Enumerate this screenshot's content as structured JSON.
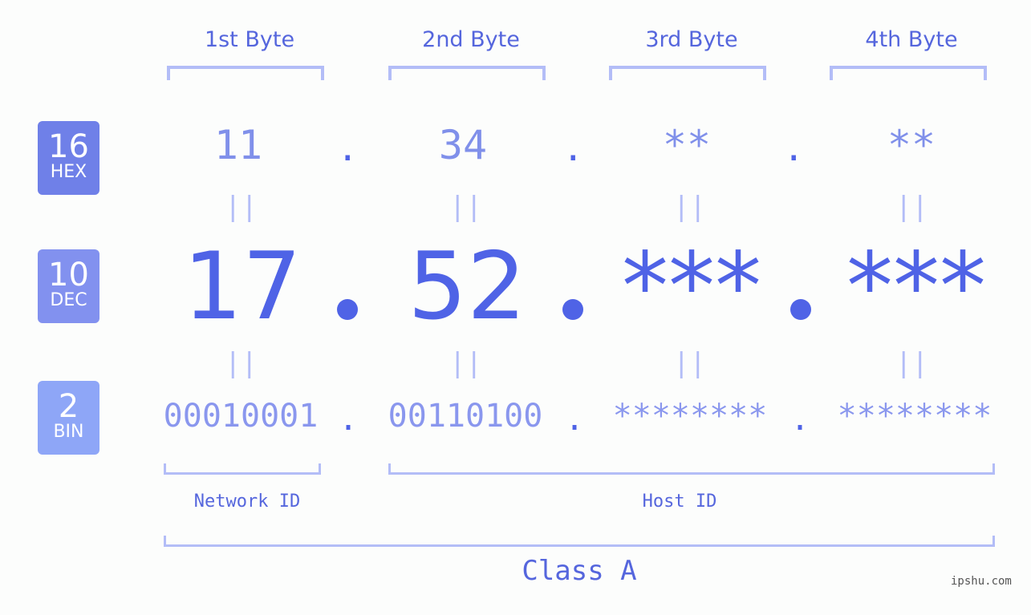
{
  "headers": [
    "1st Byte",
    "2nd Byte",
    "3rd Byte",
    "4th Byte"
  ],
  "badges": [
    {
      "num": "16",
      "label": "HEX",
      "color": "#6f80e8"
    },
    {
      "num": "10",
      "label": "DEC",
      "color": "#8291ef"
    },
    {
      "num": "2",
      "label": "BIN",
      "color": "#8ea6f7"
    }
  ],
  "hex": [
    "11",
    "34",
    "**",
    "**"
  ],
  "dec": [
    "17",
    "52",
    "***",
    "***"
  ],
  "bin": [
    "00010001",
    "00110100",
    "********",
    "********"
  ],
  "separator": ".",
  "equals": "||",
  "labels": {
    "network": "Network ID",
    "host": "Host ID",
    "class": "Class A"
  },
  "watermark": "ipshu.com"
}
